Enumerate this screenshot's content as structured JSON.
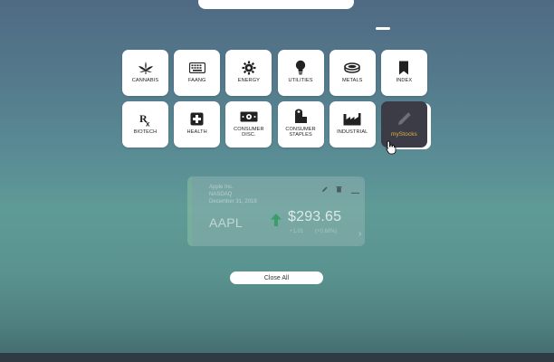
{
  "categories": [
    {
      "label": "CANNABIS",
      "icon": "cannabis-leaf-icon"
    },
    {
      "label": "FAANG",
      "icon": "keyboard-icon"
    },
    {
      "label": "ENERGY",
      "icon": "gear-icon"
    },
    {
      "label": "UTILITIES",
      "icon": "lightbulb-icon"
    },
    {
      "label": "METALS",
      "icon": "metal-ring-icon"
    },
    {
      "label": "INDEX",
      "icon": "bookmark-icon"
    },
    {
      "label": "BIOTECH",
      "icon": "rx-icon"
    },
    {
      "label": "HEALTH",
      "icon": "medical-cross-icon"
    },
    {
      "label": "CONSUMER DISC.",
      "icon": "money-icon"
    },
    {
      "label": "CONSUMER STAPLES",
      "icon": "toilet-paper-icon"
    },
    {
      "label": "INDUSTRIAL",
      "icon": "factory-icon"
    },
    {
      "label": "myStocks",
      "icon": "pencil-icon"
    }
  ],
  "stock_card": {
    "company": "Apple Inc.",
    "exchange": "NASDAQ",
    "date": "December 31, 2019",
    "ticker": "AAPL",
    "price": "$293.65",
    "change": "+1.01",
    "change_percent": "(+0.60%)"
  },
  "close_all_label": "Close All",
  "colors": {
    "accent": "#e3b24a",
    "up_arrow": "#3a9e6a",
    "dark_tile": "#3b3c45"
  }
}
